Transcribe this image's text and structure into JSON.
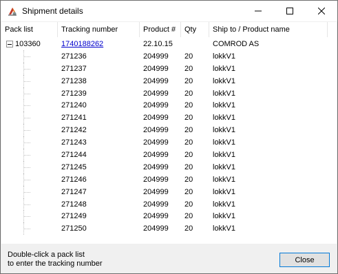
{
  "window": {
    "title": "Shipment details",
    "icon": "app-icon"
  },
  "columns": {
    "pack_list": "Pack list",
    "tracking_number": "Tracking number",
    "product": "Product #",
    "qty": "Qty",
    "ship_to": "Ship to / Product name"
  },
  "parent_row": {
    "pack_list": "103360",
    "tracking_number": "1740188262",
    "product": "22.10.15",
    "qty": "",
    "ship_to": "COMROD AS",
    "expanded": true
  },
  "rows": [
    {
      "tracking": "271236",
      "product": "204999",
      "qty": "20",
      "name": "lokkV1"
    },
    {
      "tracking": "271237",
      "product": "204999",
      "qty": "20",
      "name": "lokkV1"
    },
    {
      "tracking": "271238",
      "product": "204999",
      "qty": "20",
      "name": "lokkV1"
    },
    {
      "tracking": "271239",
      "product": "204999",
      "qty": "20",
      "name": "lokkV1"
    },
    {
      "tracking": "271240",
      "product": "204999",
      "qty": "20",
      "name": "lokkV1"
    },
    {
      "tracking": "271241",
      "product": "204999",
      "qty": "20",
      "name": "lokkV1"
    },
    {
      "tracking": "271242",
      "product": "204999",
      "qty": "20",
      "name": "lokkV1"
    },
    {
      "tracking": "271243",
      "product": "204999",
      "qty": "20",
      "name": "lokkV1"
    },
    {
      "tracking": "271244",
      "product": "204999",
      "qty": "20",
      "name": "lokkV1"
    },
    {
      "tracking": "271245",
      "product": "204999",
      "qty": "20",
      "name": "lokkV1"
    },
    {
      "tracking": "271246",
      "product": "204999",
      "qty": "20",
      "name": "lokkV1"
    },
    {
      "tracking": "271247",
      "product": "204999",
      "qty": "20",
      "name": "lokkV1"
    },
    {
      "tracking": "271248",
      "product": "204999",
      "qty": "20",
      "name": "lokkV1"
    },
    {
      "tracking": "271249",
      "product": "204999",
      "qty": "20",
      "name": "lokkV1"
    },
    {
      "tracking": "271250",
      "product": "204999",
      "qty": "20",
      "name": "lokkV1"
    }
  ],
  "footer": {
    "hint_line1": "Double-click a pack list",
    "hint_line2": "to enter the tracking number",
    "close_label": "Close"
  },
  "colors": {
    "accent": "#0078d7",
    "link": "#0000cc"
  }
}
